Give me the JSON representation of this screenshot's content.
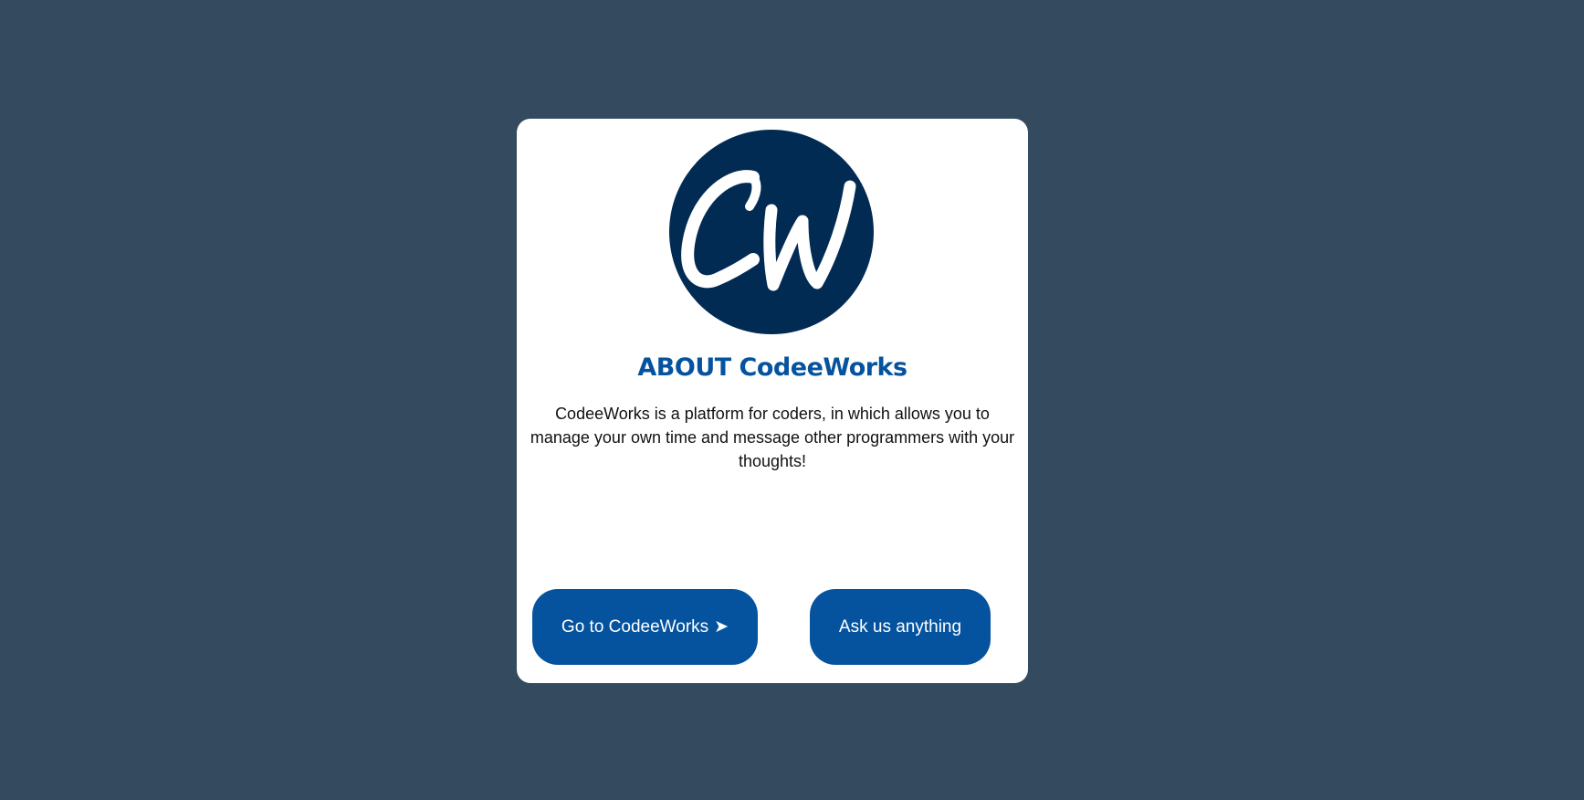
{
  "colors": {
    "background": "#344a5f",
    "card": "#ffffff",
    "brand": "#05539e",
    "logo_circle": "#022b54",
    "text": "#111111",
    "button_text": "#ffffff"
  },
  "logo": {
    "text": "CW",
    "icon": "codeeworks-logo-icon"
  },
  "about": {
    "title": "ABOUT CodeeWorks",
    "description": "CodeeWorks is a platform for coders, in which allows you to manage your own time and message other programmers with your thoughts!"
  },
  "buttons": {
    "go_label": "Go to CodeeWorks",
    "go_arrow": "➤",
    "ask_label": "Ask us anything"
  }
}
